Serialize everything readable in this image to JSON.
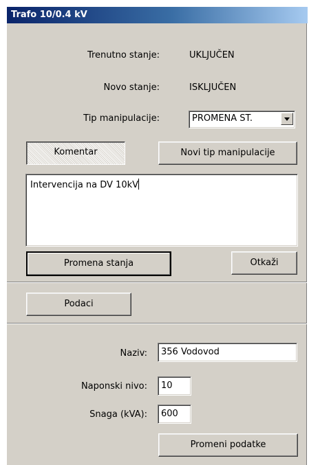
{
  "window": {
    "title": "Trafo 10/0.4 kV"
  },
  "state": {
    "current_label": "Trenutno stanje:",
    "current_value": "UKLJUČEN",
    "new_label": "Novo stanje:",
    "new_value": "ISKLJUČEN",
    "type_label": "Tip manipulacije:",
    "type_value": "PROMENA ST."
  },
  "buttons": {
    "comment": "Komentar",
    "new_type": "Novi tip manipulacije",
    "change_state": "Promena stanja",
    "cancel": "Otkaži",
    "data": "Podaci",
    "change_data": "Promeni podatke"
  },
  "comment_text": "Intervencija na DV 10kV",
  "details": {
    "name_label": "Naziv:",
    "name_value": "356 Vodovod",
    "voltage_label": "Naponski nivo:",
    "voltage_value": "10",
    "power_label": "Snaga (kVA):",
    "power_value": "600"
  },
  "icons": {
    "dropdown": "chevron-down-icon"
  }
}
